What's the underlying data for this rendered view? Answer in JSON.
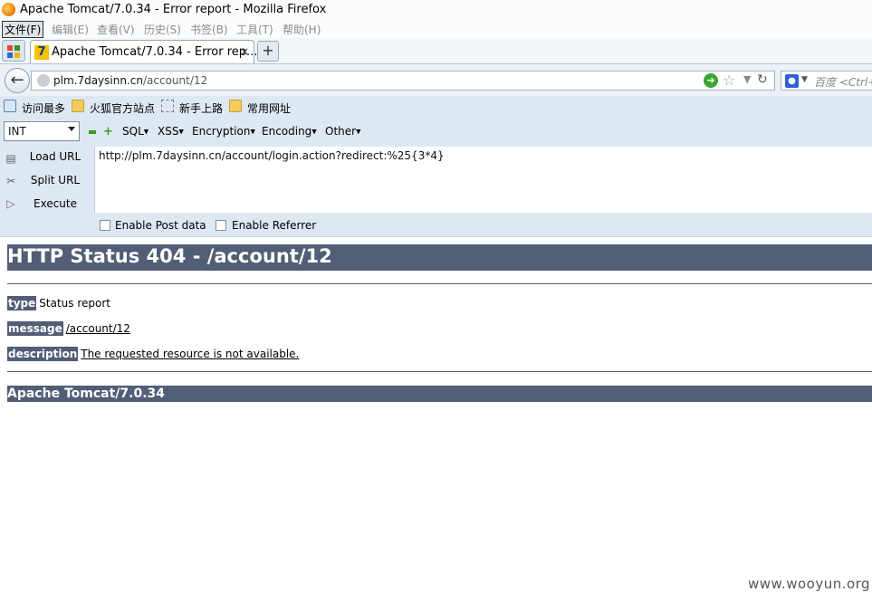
{
  "window": {
    "title": "Apache Tomcat/7.0.34 - Error report - Mozilla Firefox"
  },
  "menubar": {
    "items": [
      "文件(F)",
      "编辑(E)",
      "查看(V)",
      "历史(S)",
      "书签(B)",
      "工具(T)",
      "帮助(H)"
    ]
  },
  "tabs": {
    "active_title": "Apache Tomcat/7.0.34 - Error rep...",
    "close": "×",
    "new_tab": "+"
  },
  "navbar": {
    "url_host": "plm.7daysinn.cn",
    "url_path": "/account/12",
    "search_placeholder": "百度 <Ctrl+"
  },
  "bookmarks": [
    "访问最多",
    "火狐官方站点",
    "新手上路",
    "常用网址"
  ],
  "hackbar": {
    "type_select": "INT",
    "menus": [
      "SQL",
      "XSS",
      "Encryption",
      "Encoding",
      "Other"
    ],
    "buttons": {
      "load": "Load URL",
      "split": "Split URL",
      "execute": "Execute"
    },
    "url_text": "http://plm.7daysinn.cn/account/login.action?redirect:%25{3*4}",
    "enable_post": "Enable Post data",
    "enable_referrer": "Enable Referrer"
  },
  "page": {
    "heading": "HTTP Status 404 - /account/12",
    "type_key": "type",
    "type_val": "Status report",
    "message_key": "message",
    "message_val": "/account/12",
    "description_key": "description",
    "description_val": "The requested resource is not available.",
    "footer": "Apache Tomcat/7.0.34"
  },
  "watermark": "www.wooyun.org",
  "colors": {
    "tomcat_bar": "#525d76",
    "toolbar_bg": "#dde8f3"
  }
}
